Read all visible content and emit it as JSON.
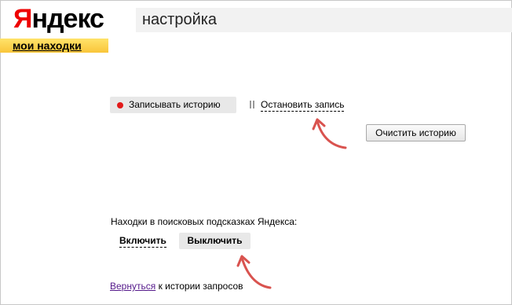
{
  "logo": {
    "first_letter": "Я",
    "rest": "ндекс"
  },
  "section_tab": {
    "label": "мои находки"
  },
  "page": {
    "title": "настройка"
  },
  "history": {
    "record_label": "Записывать историю",
    "stop_label": "Остановить запись",
    "clear_label": "Очистить историю"
  },
  "suggest": {
    "label": "Находки в поисковых подсказках Яндекса:",
    "enable_label": "Включить",
    "disable_label": "Выключить"
  },
  "footer": {
    "back_link": "Вернуться",
    "back_rest": " к истории запросов"
  },
  "colors": {
    "accent_red": "#e21a1a",
    "tab_yellow": "#f9c53a",
    "annotation_arrow": "#d9534f"
  },
  "icons": {
    "record": "record-dot-icon",
    "pause": "pause-icon",
    "arrow": "annotation-arrow-icon"
  }
}
